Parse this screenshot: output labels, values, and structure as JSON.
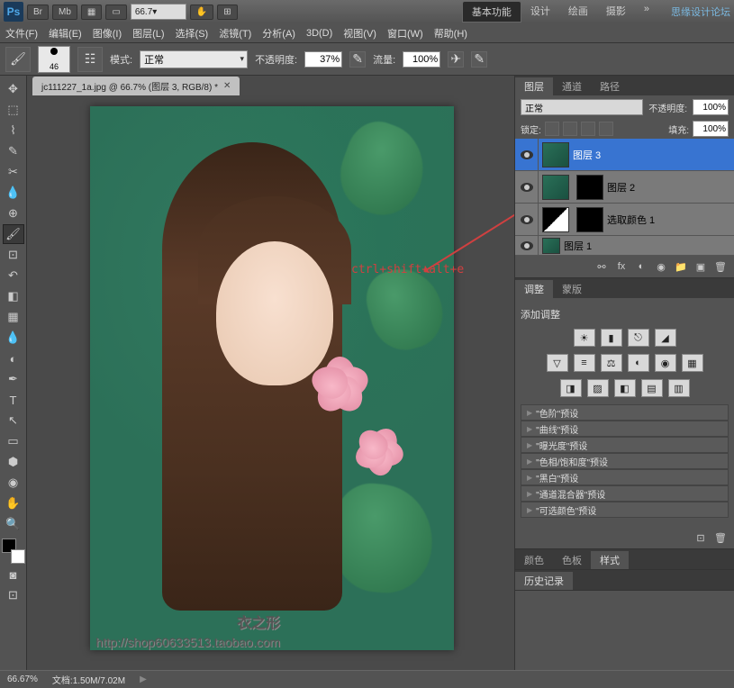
{
  "title": {
    "zoom": "66.7",
    "workspace_tabs": [
      "基本功能",
      "设计",
      "绘画",
      "摄影"
    ],
    "watermark": "思缘设计论坛"
  },
  "menu": [
    "文件(F)",
    "编辑(E)",
    "图像(I)",
    "图层(L)",
    "选择(S)",
    "滤镜(T)",
    "分析(A)",
    "3D(D)",
    "视图(V)",
    "窗口(W)",
    "帮助(H)"
  ],
  "options": {
    "brush_size": "46",
    "mode_label": "模式:",
    "mode_value": "正常",
    "opacity_label": "不透明度:",
    "opacity_value": "37%",
    "flow_label": "流量:",
    "flow_value": "100%"
  },
  "doc_tab": "jc111227_1a.jpg @ 66.7% (图层 3, RGB/8) *",
  "annotation": "ctrl+shift+alt+e",
  "layers_panel": {
    "tabs": [
      "图层",
      "通道",
      "路径"
    ],
    "blend_mode": "正常",
    "opacity_label": "不透明度:",
    "opacity_value": "100%",
    "lock_label": "锁定:",
    "fill_label": "填充:",
    "fill_value": "100%",
    "layers": [
      {
        "name": "图层 3",
        "selected": true
      },
      {
        "name": "图层 2"
      },
      {
        "name": "选取颜色 1",
        "adj": true
      },
      {
        "name": "图层 1"
      }
    ]
  },
  "adjustments": {
    "tabs": [
      "调整",
      "蒙版"
    ],
    "title": "添加调整",
    "presets": [
      "\"色阶\"预设",
      "\"曲线\"预设",
      "\"曝光度\"预设",
      "\"色相/饱和度\"预设",
      "\"黑白\"预设",
      "\"通道混合器\"预设",
      "\"可选颜色\"预设"
    ]
  },
  "bottom_tabs": [
    "颜色",
    "色板",
    "样式"
  ],
  "history_tab": "历史记录",
  "status": {
    "zoom": "66.67%",
    "doc_info": "文档:1.50M/7.02M"
  },
  "watermark_bottom": {
    "line1": "衣之形",
    "line2": "http://shop60633513.taobao.com"
  }
}
